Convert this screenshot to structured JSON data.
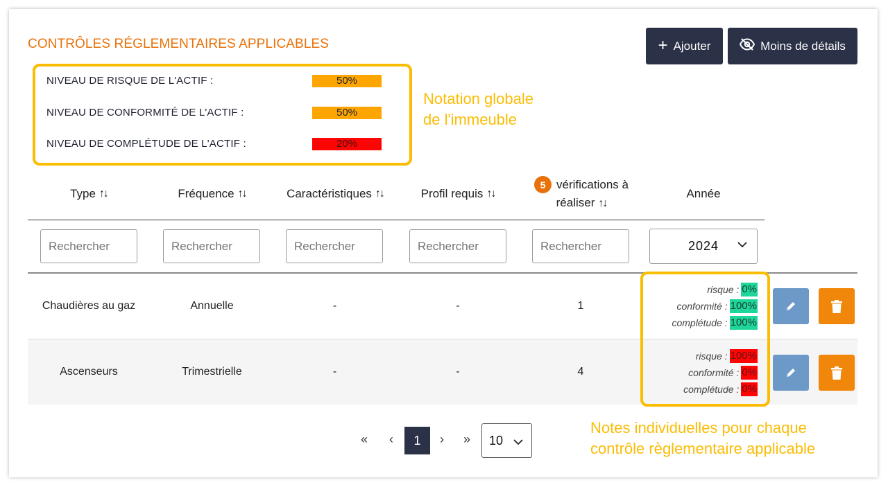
{
  "section_title": "CONTRÔLES RÉGLEMENTAIRES APPLICABLES",
  "toolbar": {
    "add_label": "Ajouter",
    "less_details_label": "Moins de détails"
  },
  "global_scores": [
    {
      "label": "NIVEAU DE RISQUE DE L'ACTIF :",
      "value": "50%",
      "fraction": 0.5,
      "color": "#fea500"
    },
    {
      "label": "NIVEAU DE CONFORMITÉ DE L'ACTIF :",
      "value": "50%",
      "fraction": 0.5,
      "color": "#fea500"
    },
    {
      "label": "NIVEAU DE COMPLÉTUDE DE L'ACTIF :",
      "value": "20%",
      "fraction": 0.2,
      "color": "#fb0505"
    }
  ],
  "annotations": {
    "global_line1": "Notation globale",
    "global_line2": "de l'immeuble",
    "individual_line1": "Notes individuelles pour chaque",
    "individual_line2": "contrôle règlementaire applicable"
  },
  "table": {
    "columns": {
      "type": "Type",
      "frequence": "Fréquence",
      "caracteristiques": "Caractéristiques",
      "profil": "Profil requis",
      "verif_count": "5",
      "verif_line1": "vérifications à",
      "verif_line2": "réaliser",
      "annee": "Année"
    },
    "sort_glyph": "↑↓",
    "search_placeholder": "Rechercher",
    "year_selected": "2024",
    "rows": [
      {
        "type": "Chaudières au gaz",
        "frequence": "Annuelle",
        "caracteristiques": "-",
        "profil": "-",
        "verifications": "1",
        "scores": {
          "risque_label": "risque :",
          "risque": "0%",
          "conformite_label": "conformité :",
          "conformite": "100%",
          "completude_label": "complétude :",
          "completude": "100%"
        }
      },
      {
        "type": "Ascenseurs",
        "frequence": "Trimestrielle",
        "caracteristiques": "-",
        "profil": "-",
        "verifications": "4",
        "scores": {
          "risque_label": "risque :",
          "risque": "100%",
          "conformite_label": "conformité :",
          "conformite": "0%",
          "completude_label": "complétude :",
          "completude": "0%"
        }
      }
    ]
  },
  "pagination": {
    "first": "«",
    "prev": "‹",
    "current": "1",
    "next": "›",
    "last": "»",
    "per_page": "10"
  },
  "colors": {
    "accent": "#e8710a",
    "dark_button": "#2b3147",
    "highlight": "#fbbc04",
    "good": "#1fd69a",
    "bad": "#fb0505"
  }
}
